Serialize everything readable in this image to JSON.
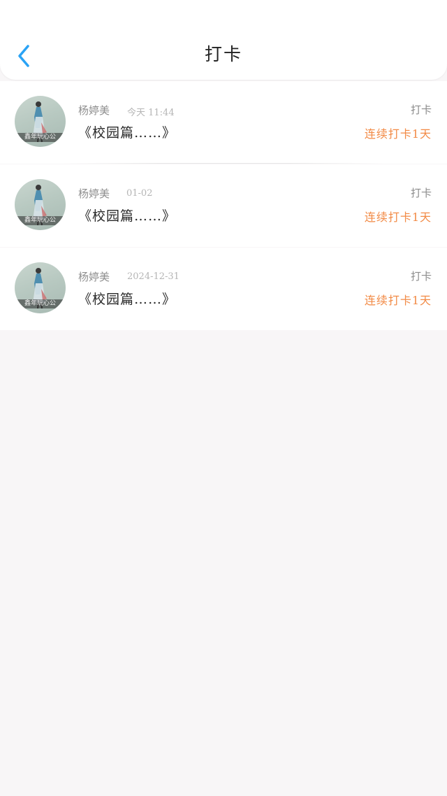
{
  "header": {
    "title": "打卡",
    "back_icon": "chevron-left-icon",
    "accent_color": "#2aa3f5"
  },
  "records": [
    {
      "name": "杨婷美",
      "time": "今天 11:44",
      "content": "《校园篇……》",
      "tag": "打卡",
      "streak": "连续打卡1天",
      "avatar_watermark": "鑫年玩心公"
    },
    {
      "name": "杨婷美",
      "time": "01-02",
      "content": "《校园篇……》",
      "tag": "打卡",
      "streak": "连续打卡1天",
      "avatar_watermark": "鑫年玩心公"
    },
    {
      "name": "杨婷美",
      "time": "2024-12-31",
      "content": "《校园篇……》",
      "tag": "打卡",
      "streak": "连续打卡1天",
      "avatar_watermark": "鑫年玩心公"
    }
  ],
  "colors": {
    "streak": "#f28a45",
    "background": "#f8f6f7"
  }
}
